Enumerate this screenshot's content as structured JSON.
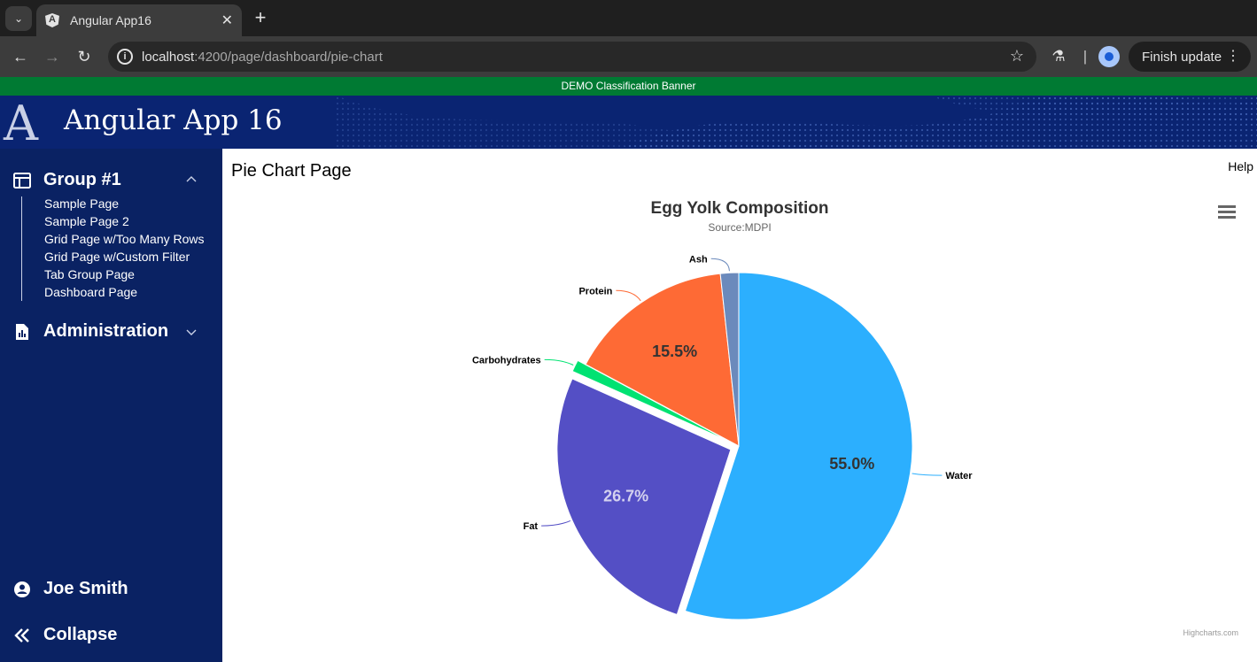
{
  "browser": {
    "tab_title": "Angular App16",
    "url_host": "localhost",
    "url_path": ":4200/page/dashboard/pie-chart",
    "finish_update_label": "Finish update"
  },
  "app": {
    "banner": "DEMO Classification Banner",
    "logo_letter": "A",
    "title": "Angular App 16"
  },
  "sidebar": {
    "group1": {
      "label": "Group #1",
      "items": [
        "Sample Page",
        "Sample Page 2",
        "Grid Page w/Too Many Rows",
        "Grid Page w/Custom Filter",
        "Tab Group Page",
        "Dashboard Page"
      ]
    },
    "group2": {
      "label": "Administration"
    },
    "user": {
      "label": "Joe Smith"
    },
    "collapse": {
      "label": "Collapse"
    }
  },
  "main": {
    "page_title": "Pie Chart Page",
    "help_label": "Help",
    "credits": "Highcharts.com"
  },
  "chart_data": {
    "type": "pie",
    "title": "Egg Yolk Composition",
    "subtitle": "Source:MDPI",
    "slices": [
      {
        "name": "Water",
        "value": 55.0,
        "color": "#2caffe",
        "sliced": false,
        "show_pct": true,
        "pct_label": "55.0%"
      },
      {
        "name": "Fat",
        "value": 26.7,
        "color": "#544fc5",
        "sliced": true,
        "show_pct": true,
        "pct_label": "26.7%"
      },
      {
        "name": "Carbohydrates",
        "value": 1.1,
        "color": "#00e272",
        "sliced": true,
        "show_pct": false,
        "pct_label": ""
      },
      {
        "name": "Protein",
        "value": 15.5,
        "color": "#fe6a35",
        "sliced": false,
        "show_pct": true,
        "pct_label": "15.5%"
      },
      {
        "name": "Ash",
        "value": 1.7,
        "color": "#6b8abc",
        "sliced": false,
        "show_pct": false,
        "pct_label": ""
      }
    ]
  }
}
